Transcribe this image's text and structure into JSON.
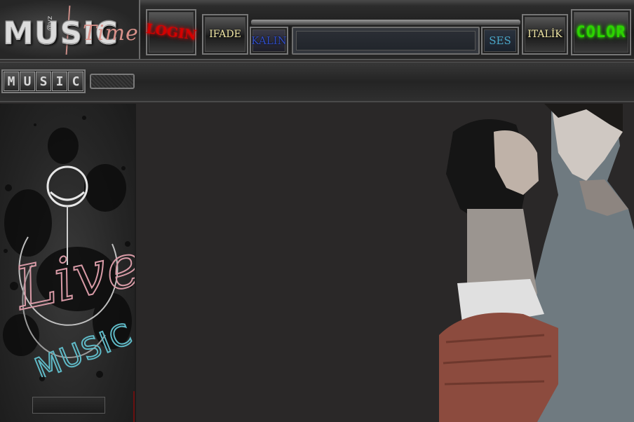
{
  "header": {
    "logo": {
      "text": "MUSIC",
      "at_text": "@yz",
      "script_text": "Time"
    },
    "buttons": {
      "login": "LOGIN",
      "ifade": "IFADE",
      "kalin": "KALIN",
      "ses": "SES",
      "italik": "ITALİK",
      "color": "COLOR"
    },
    "message_input": {
      "value": "",
      "placeholder": ""
    }
  },
  "tabs": {
    "music_letters": [
      "M",
      "U",
      "S",
      "I",
      "C"
    ]
  },
  "sidebar": {
    "art_script": "Live",
    "art_text": "MUSIC"
  },
  "colors": {
    "login": "#d40000",
    "color_button": "#2cd300",
    "kalin": "#2f4cc4",
    "ses": "#4aa6c8",
    "gold_text": "#f1e7a5",
    "background": "#2a2828"
  }
}
